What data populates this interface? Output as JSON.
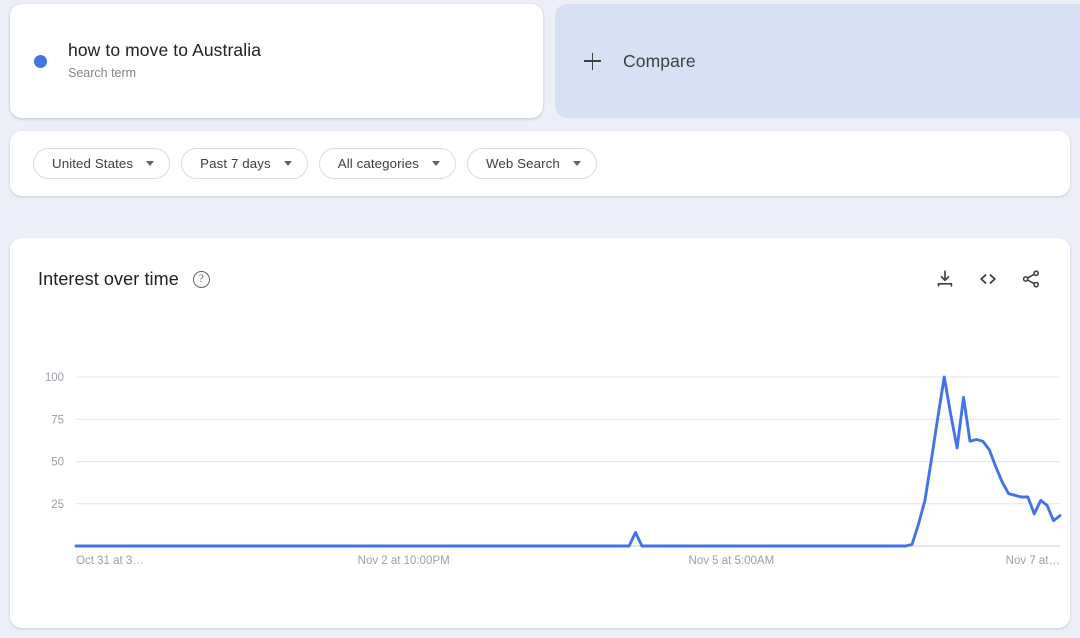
{
  "term": {
    "name": "how to move to Australia",
    "type_label": "Search term",
    "dot_color": "#4472e8"
  },
  "compare": {
    "label": "Compare",
    "icon": "plus-icon"
  },
  "filters": [
    {
      "label": "United States",
      "icon": "chevron-down-icon"
    },
    {
      "label": "Past 7 days",
      "icon": "chevron-down-icon"
    },
    {
      "label": "All categories",
      "icon": "chevron-down-icon"
    },
    {
      "label": "Web Search",
      "icon": "chevron-down-icon"
    }
  ],
  "chart_card": {
    "title": "Interest over time",
    "help_icon": "help-circle-icon",
    "actions": [
      {
        "name": "download-icon",
        "tooltip": "Download"
      },
      {
        "name": "embed-code-icon",
        "tooltip": "Embed"
      },
      {
        "name": "share-icon",
        "tooltip": "Share"
      }
    ]
  },
  "chart_data": {
    "type": "line",
    "title": "Interest over time",
    "xlabel": "",
    "ylabel": "",
    "ylim": [
      0,
      105
    ],
    "grid": true,
    "legend_position": "none",
    "line_color": "#4472e8",
    "ytick_labels": [
      "100",
      "75",
      "50",
      "25"
    ],
    "ytick_values": [
      100,
      75,
      50,
      25
    ],
    "xtick_labels": [
      "Oct 31 at 3…",
      "Nov 2 at 10:00PM",
      "Nov 5 at 5:00AM",
      "Nov 7 at…"
    ],
    "xtick_positions": [
      0,
      33.3,
      66.6,
      100
    ],
    "series": [
      {
        "name": "how to move to Australia",
        "values": [
          0,
          0,
          0,
          0,
          0,
          0,
          0,
          0,
          0,
          0,
          0,
          0,
          0,
          0,
          0,
          0,
          0,
          0,
          0,
          0,
          0,
          0,
          0,
          0,
          0,
          0,
          0,
          0,
          0,
          0,
          0,
          0,
          0,
          0,
          0,
          0,
          0,
          0,
          0,
          0,
          0,
          0,
          0,
          0,
          0,
          0,
          0,
          0,
          0,
          0,
          0,
          0,
          0,
          0,
          0,
          0,
          0,
          0,
          0,
          0,
          0,
          0,
          0,
          0,
          0,
          0,
          0,
          0,
          0,
          0,
          0,
          0,
          0,
          0,
          0,
          0,
          0,
          0,
          0,
          0,
          0,
          0,
          0,
          0,
          0,
          0,
          0,
          8,
          0,
          0,
          0,
          0,
          0,
          0,
          0,
          0,
          0,
          0,
          0,
          0,
          0,
          0,
          0,
          0,
          0,
          0,
          0,
          0,
          0,
          0,
          0,
          0,
          0,
          0,
          0,
          0,
          0,
          0,
          0,
          0,
          0,
          0,
          0,
          0,
          0,
          0,
          0,
          0,
          0,
          0,
          1,
          13,
          27,
          51,
          76,
          100,
          78,
          58,
          88,
          62,
          63,
          62,
          57,
          47,
          38,
          31,
          30,
          29,
          29,
          19,
          27,
          24,
          15,
          18
        ]
      }
    ]
  }
}
